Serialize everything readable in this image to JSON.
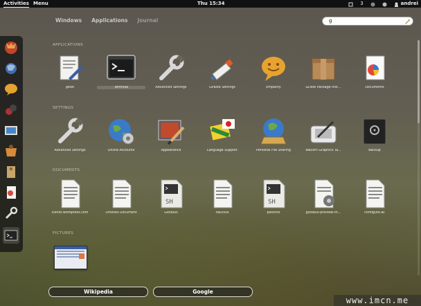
{
  "panel": {
    "activities": "Activities",
    "menu": "Menu",
    "clock": "Thu 15:34",
    "workspace_count": "3",
    "user": "andrei"
  },
  "view_tabs": [
    "Windows",
    "Applications",
    "Journal"
  ],
  "search": {
    "value": "g"
  },
  "sections": {
    "applications": "APPLICATIONS",
    "settings": "SETTINGS",
    "documents": "DOCUMENTS",
    "pictures": "PICTURES"
  },
  "applications": [
    {
      "label": "gedit",
      "icon": "gedit-icon"
    },
    {
      "label": "Terminal",
      "icon": "terminal-icon"
    },
    {
      "label": "Advanced Settings",
      "icon": "wrench-icon"
    },
    {
      "label": "GPaste Settings",
      "icon": "paste-tube-icon"
    },
    {
      "label": "Empathy",
      "icon": "empathy-icon"
    },
    {
      "label": "GDebi Package Inst...",
      "icon": "package-icon"
    },
    {
      "label": "Documents",
      "icon": "documents-icon"
    }
  ],
  "settings": [
    {
      "label": "Advanced Settings",
      "icon": "wrench-icon"
    },
    {
      "label": "Online Accounts",
      "icon": "globe-icon"
    },
    {
      "label": "Appearance",
      "icon": "appearance-icon"
    },
    {
      "label": "Language Support",
      "icon": "flags-icon"
    },
    {
      "label": "Personal File Sharing",
      "icon": "file-sharing-icon"
    },
    {
      "label": "Wacom Graphics Ta...",
      "icon": "tablet-icon"
    },
    {
      "label": "Backup",
      "icon": "safe-icon"
    }
  ],
  "documents": [
    {
      "label": "icehot.wordpress.com",
      "icon": "text-file-icon"
    },
    {
      "label": "Untitled Document",
      "icon": "text-file-icon"
    },
    {
      "label": "Gloobus",
      "icon": "shell-script-icon"
    },
    {
      "label": "nautilus",
      "icon": "text-file-icon"
    },
    {
      "label": "postinst",
      "icon": "shell-script-icon"
    },
    {
      "label": "gloobus-preview-th...",
      "icon": "text-file-icon"
    },
    {
      "label": "configure.ac",
      "icon": "text-file-icon"
    }
  ],
  "search_providers": [
    "Wikipedia",
    "Google"
  ],
  "watermark": "www.imcn.me",
  "colors": {
    "panel": "#111111",
    "dash": "#141414",
    "accent": "#3a5fa8"
  }
}
